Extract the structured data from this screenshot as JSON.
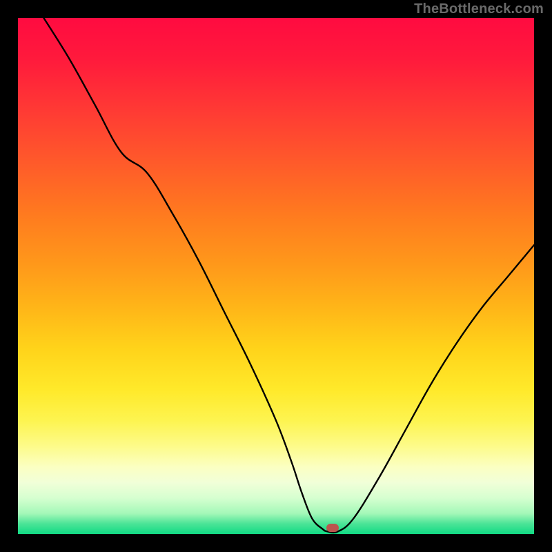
{
  "attribution": "TheBottleneck.com",
  "chart_data": {
    "type": "line",
    "title": "",
    "xlabel": "",
    "ylabel": "",
    "xlim": [
      0,
      100
    ],
    "ylim": [
      0,
      100
    ],
    "series": [
      {
        "name": "bottleneck-curve",
        "x": [
          5,
          10,
          15,
          20,
          25,
          30,
          35,
          40,
          45,
          50,
          53,
          55,
          57,
          59,
          60,
          62,
          65,
          70,
          75,
          80,
          85,
          90,
          95,
          100
        ],
        "values": [
          100,
          92,
          83,
          74,
          70,
          62,
          53,
          43,
          33,
          22,
          14,
          8,
          3,
          1,
          0.5,
          0.5,
          3,
          11,
          20,
          29,
          37,
          44,
          50,
          56
        ]
      }
    ],
    "marker": {
      "x": 61,
      "y": 1.2
    },
    "background_gradient": {
      "top": "#ff0b40",
      "bottom": "#11da84"
    }
  }
}
